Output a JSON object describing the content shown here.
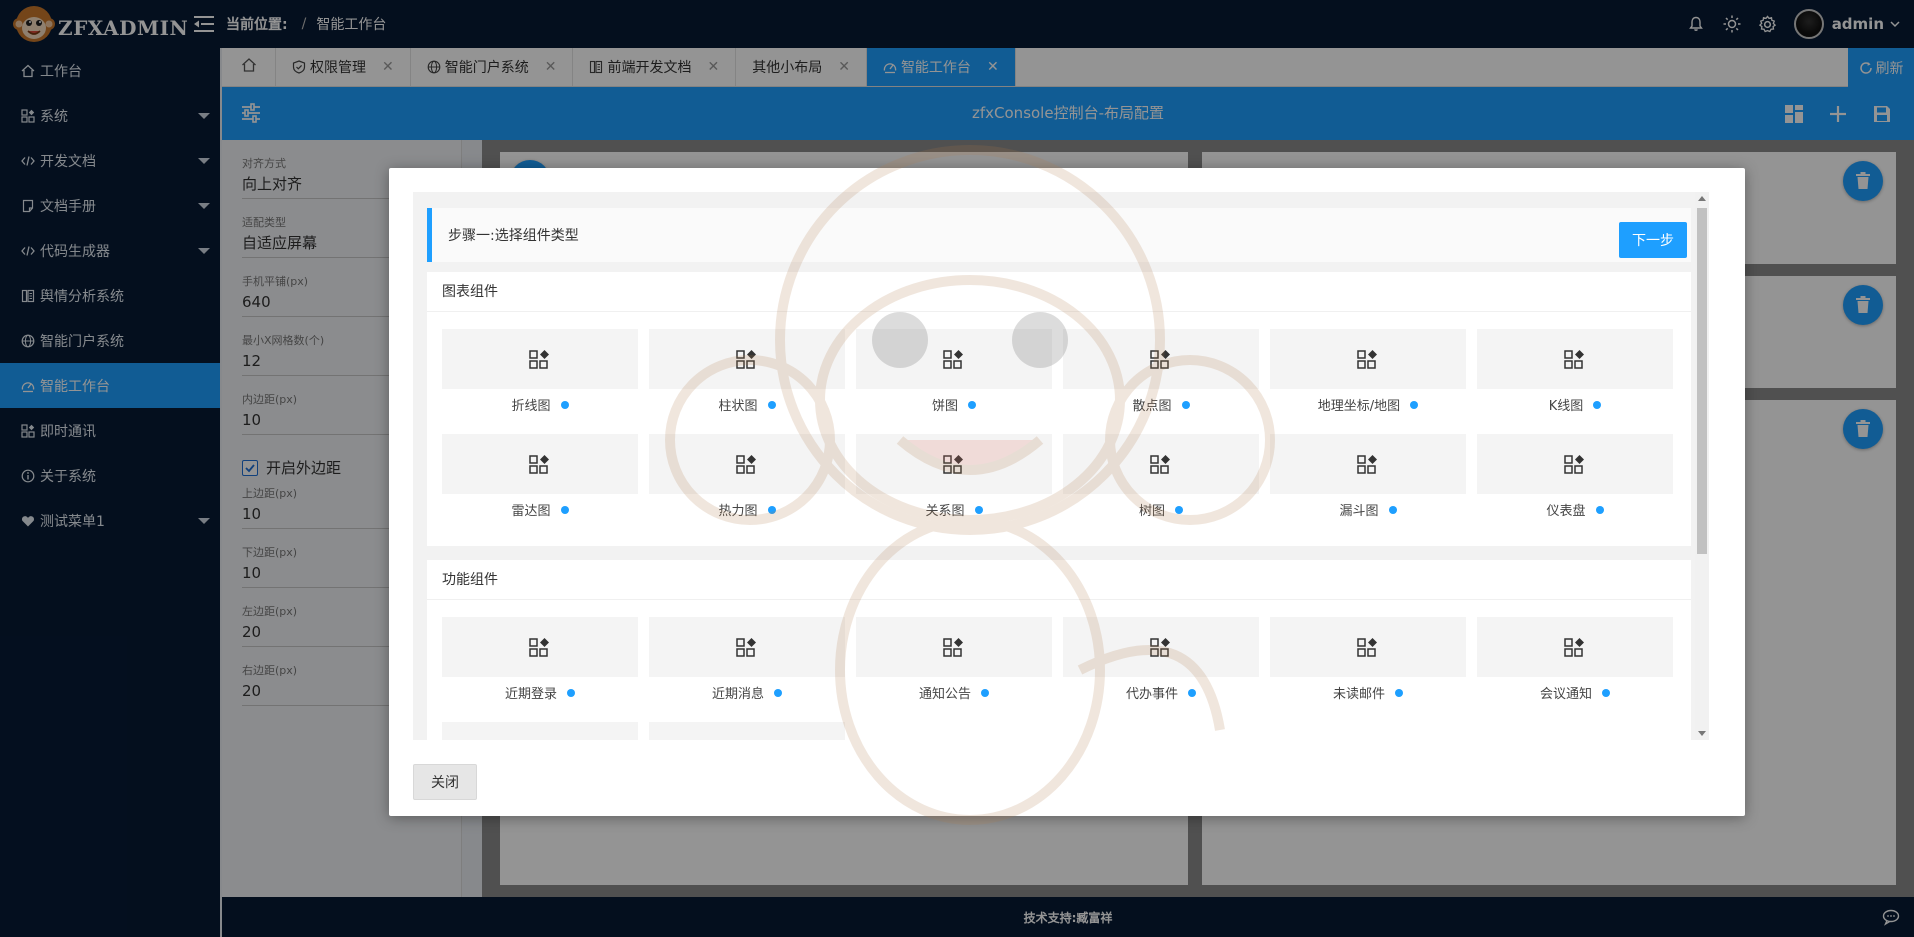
{
  "app": {
    "logo_text": "ZFXADMIN",
    "breadcrumb_lead": "当前位置:",
    "breadcrumb_sep": "/",
    "breadcrumb_current": "智能工作台",
    "user_name": "admin"
  },
  "sidebar": {
    "items": [
      {
        "label": "工作台",
        "icon": "home-icon"
      },
      {
        "label": "系统",
        "icon": "apps-icon"
      },
      {
        "label": "开发文档",
        "icon": "code-icon"
      },
      {
        "label": "文档手册",
        "icon": "note-icon"
      },
      {
        "label": "代码生成器",
        "icon": "code-icon"
      },
      {
        "label": "舆情分析系统",
        "icon": "analysis-icon"
      },
      {
        "label": "智能门户系统",
        "icon": "globe-icon"
      },
      {
        "label": "智能工作台",
        "icon": "dashboard-icon"
      },
      {
        "label": "即时通讯",
        "icon": "apps-icon"
      },
      {
        "label": "关于系统",
        "icon": "info-icon"
      },
      {
        "label": "测试菜单1",
        "icon": "heart-icon"
      }
    ],
    "active_index": 7
  },
  "tabs": {
    "items": [
      {
        "label": "权限管理",
        "icon": "shield-icon"
      },
      {
        "label": "智能门户系统",
        "icon": "globe-icon"
      },
      {
        "label": "前端开发文档",
        "icon": "analysis-icon"
      },
      {
        "label": "其他小布局",
        "icon": ""
      },
      {
        "label": "智能工作台",
        "icon": "dashboard-icon"
      }
    ],
    "active_index": 4,
    "close_glyph": "✕",
    "refresh_label": "刷新"
  },
  "page": {
    "title": "zfxConsole控制台-布局配置"
  },
  "config": {
    "fields_top": [
      {
        "label": "对齐方式",
        "value": "向上对齐"
      },
      {
        "label": "适配类型",
        "value": "自适应屏幕"
      },
      {
        "label": "手机平铺(px)",
        "value": "640"
      },
      {
        "label": "最小X网格数(个)",
        "value": "12"
      },
      {
        "label": "内边距(px)",
        "value": "10"
      }
    ],
    "margin_checkbox_label": "开启外边距",
    "margin_checked": true,
    "fields_bottom": [
      {
        "label": "上边距(px)",
        "value": "10"
      },
      {
        "label": "下边距(px)",
        "value": "10"
      },
      {
        "label": "左边距(px)",
        "value": "20"
      },
      {
        "label": "右边距(px)",
        "value": "20"
      }
    ]
  },
  "modal": {
    "step_title": "步骤一:选择组件类型",
    "next_label": "下一步",
    "close_label": "关闭",
    "chart_section_title": "图表组件",
    "chart_items": [
      "折线图",
      "柱状图",
      "饼图",
      "散点图",
      "地理坐标/地图",
      "K线图",
      "雷达图",
      "热力图",
      "关系图",
      "树图",
      "漏斗图",
      "仪表盘"
    ],
    "func_section_title": "功能组件",
    "func_items": [
      "近期登录",
      "近期消息",
      "通知公告",
      "代办事件",
      "未读邮件",
      "会议通知",
      "",
      ""
    ]
  },
  "footer": {
    "tech_support": "技术支持:臧富祥"
  },
  "colors": {
    "navy": "#071a35",
    "accent": "#1e9fff"
  }
}
